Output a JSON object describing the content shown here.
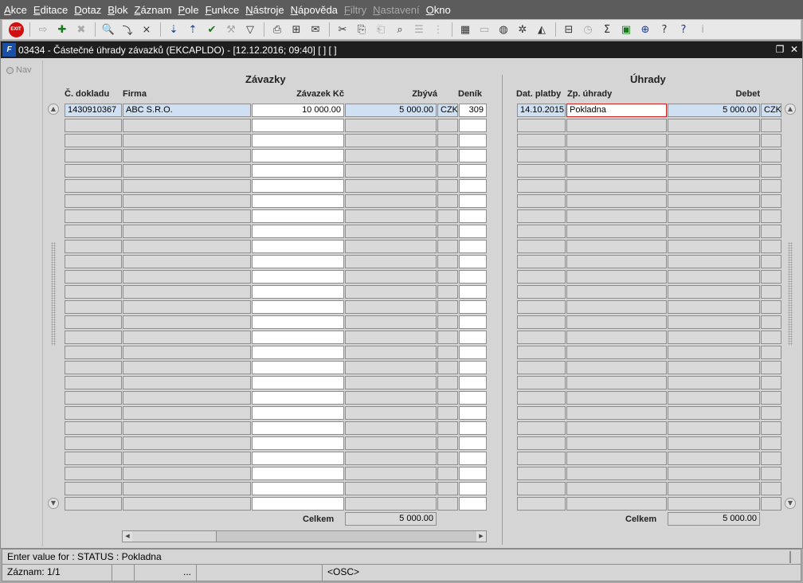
{
  "menu": [
    {
      "label": "Akce",
      "underline": "A",
      "rest": "kce",
      "disabled": false
    },
    {
      "label": "Editace",
      "underline": "E",
      "rest": "ditace",
      "disabled": false
    },
    {
      "label": "Dotaz",
      "underline": "D",
      "rest": "otaz",
      "disabled": false
    },
    {
      "label": "Blok",
      "underline": "B",
      "rest": "lok",
      "disabled": false
    },
    {
      "label": "Záznam",
      "underline": "Z",
      "rest": "áznam",
      "disabled": false
    },
    {
      "label": "Pole",
      "underline": "P",
      "rest": "ole",
      "disabled": false
    },
    {
      "label": "Funkce",
      "underline": "F",
      "rest": "unkce",
      "disabled": false
    },
    {
      "label": "Nástroje",
      "underline": "N",
      "rest": "ástroje",
      "disabled": false
    },
    {
      "label": "Nápověda",
      "underline": "N",
      "rest": "ápověda",
      "disabled": false
    },
    {
      "label": "Filtry",
      "underline": "F",
      "rest": "iltry",
      "disabled": true
    },
    {
      "label": "Nastavení",
      "underline": "N",
      "rest": "astavení",
      "disabled": true
    },
    {
      "label": "Okno",
      "underline": "O",
      "rest": "kno",
      "disabled": false
    }
  ],
  "toolbar": {
    "exit_label": "EXIT",
    "buttons": [
      {
        "name": "exit-icon",
        "glyph": "",
        "style": "exit"
      },
      {
        "sep": true
      },
      {
        "name": "save-disabled-icon",
        "glyph": "⇨",
        "style": "dis"
      },
      {
        "name": "new-record-icon",
        "glyph": "✚",
        "style": "green"
      },
      {
        "name": "delete-record-icon",
        "glyph": "✖",
        "style": "dis"
      },
      {
        "sep": true
      },
      {
        "name": "query-icon",
        "glyph": "🔍",
        "style": ""
      },
      {
        "name": "execute-query-icon",
        "glyph": "⤵",
        "style": ""
      },
      {
        "name": "cancel-query-icon",
        "glyph": "⨯",
        "style": ""
      },
      {
        "sep": true
      },
      {
        "name": "sort-asc-icon",
        "glyph": "⇣",
        "style": "blue"
      },
      {
        "name": "sort-desc-icon",
        "glyph": "⇡",
        "style": "blue"
      },
      {
        "name": "check-icon",
        "glyph": "✔",
        "style": "green"
      },
      {
        "name": "wrench-icon",
        "glyph": "⚒",
        "style": "dis"
      },
      {
        "name": "filter-icon",
        "glyph": "▽",
        "style": ""
      },
      {
        "sep": true
      },
      {
        "name": "print-icon",
        "glyph": "⎙",
        "style": ""
      },
      {
        "name": "print-preview-icon",
        "glyph": "⊞",
        "style": ""
      },
      {
        "name": "mail-icon",
        "glyph": "✉",
        "style": ""
      },
      {
        "sep": true
      },
      {
        "name": "cut-icon",
        "glyph": "✂",
        "style": ""
      },
      {
        "name": "copy-icon",
        "glyph": "⎘",
        "style": ""
      },
      {
        "name": "paste-icon",
        "glyph": "⎗",
        "style": "dis"
      },
      {
        "name": "find-icon",
        "glyph": "⌕",
        "style": ""
      },
      {
        "name": "list-icon",
        "glyph": "☰",
        "style": "dis"
      },
      {
        "name": "tree-icon",
        "glyph": "⋮",
        "style": "dis"
      },
      {
        "sep": true
      },
      {
        "name": "calendar-icon",
        "glyph": "▦",
        "style": ""
      },
      {
        "name": "document-icon",
        "glyph": "▭",
        "style": "dis"
      },
      {
        "name": "globe-icon",
        "glyph": "◍",
        "style": ""
      },
      {
        "name": "ship-wheel-icon",
        "glyph": "✲",
        "style": ""
      },
      {
        "name": "mountain-icon",
        "glyph": "◭",
        "style": ""
      },
      {
        "sep": true
      },
      {
        "name": "org-chart-icon",
        "glyph": "⊟",
        "style": ""
      },
      {
        "name": "clock-icon",
        "glyph": "◷",
        "style": "dis"
      },
      {
        "name": "sum-icon",
        "glyph": "Σ",
        "style": ""
      },
      {
        "name": "excel-icon",
        "glyph": "▣",
        "style": "green"
      },
      {
        "name": "web-icon",
        "glyph": "⊕",
        "style": "blue"
      },
      {
        "name": "help-folder-icon",
        "glyph": "?",
        "style": ""
      },
      {
        "name": "help-icon",
        "glyph": "?",
        "style": "blue"
      },
      {
        "name": "info-icon",
        "glyph": "i",
        "style": "dis"
      }
    ]
  },
  "window": {
    "title": "03434 - Částečné úhrady závazků (EKCAPLDO) - [12.12.2016; 09:40]  [ ]  [ ]",
    "restore_glyph": "❐",
    "close_glyph": "✕"
  },
  "nav": {
    "label": "Nav"
  },
  "zavazky": {
    "title": "Závazky",
    "columns": {
      "doklad": "Č. dokladu",
      "firma": "Firma",
      "zavazek": "Závazek Kč",
      "zbyva": "Zbývá",
      "denik": "Deník"
    },
    "rows": [
      {
        "doklad": "1430910367",
        "firma": "ABC S.R.O.",
        "zavazek": "10 000.00",
        "zbyva": "5 000.00",
        "mena": "CZK",
        "denik": "309"
      }
    ],
    "total_label": "Celkem",
    "total_value": "5 000.00"
  },
  "uhrady": {
    "title": "Úhrady",
    "columns": {
      "datum": "Dat. platby",
      "zpusob": "Zp. úhrady",
      "debet": "Debet"
    },
    "rows": [
      {
        "datum": "14.10.2015",
        "zpusob": "Pokladna",
        "debet": "5 000.00",
        "mena": "CZK"
      }
    ],
    "total_label": "Celkem",
    "total_value": "5 000.00"
  },
  "status": {
    "message": "Enter value for : STATUS : Pokladna",
    "record": "Záznam: 1/1",
    "ellipsis": "...",
    "mode": "<OSC>"
  },
  "scroll": {
    "up": "▲",
    "down": "▼",
    "left": "◀",
    "right": "▶"
  }
}
